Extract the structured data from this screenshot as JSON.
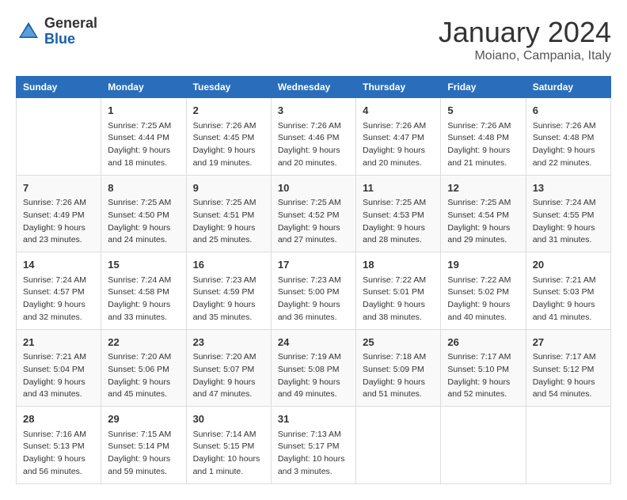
{
  "header": {
    "logo_general": "General",
    "logo_blue": "Blue",
    "month": "January 2024",
    "location": "Moiano, Campania, Italy"
  },
  "days_of_week": [
    "Sunday",
    "Monday",
    "Tuesday",
    "Wednesday",
    "Thursday",
    "Friday",
    "Saturday"
  ],
  "weeks": [
    [
      {
        "day": "",
        "details": ""
      },
      {
        "day": "1",
        "details": "Sunrise: 7:25 AM\nSunset: 4:44 PM\nDaylight: 9 hours\nand 18 minutes."
      },
      {
        "day": "2",
        "details": "Sunrise: 7:26 AM\nSunset: 4:45 PM\nDaylight: 9 hours\nand 19 minutes."
      },
      {
        "day": "3",
        "details": "Sunrise: 7:26 AM\nSunset: 4:46 PM\nDaylight: 9 hours\nand 20 minutes."
      },
      {
        "day": "4",
        "details": "Sunrise: 7:26 AM\nSunset: 4:47 PM\nDaylight: 9 hours\nand 20 minutes."
      },
      {
        "day": "5",
        "details": "Sunrise: 7:26 AM\nSunset: 4:48 PM\nDaylight: 9 hours\nand 21 minutes."
      },
      {
        "day": "6",
        "details": "Sunrise: 7:26 AM\nSunset: 4:48 PM\nDaylight: 9 hours\nand 22 minutes."
      }
    ],
    [
      {
        "day": "7",
        "details": "Sunrise: 7:26 AM\nSunset: 4:49 PM\nDaylight: 9 hours\nand 23 minutes."
      },
      {
        "day": "8",
        "details": "Sunrise: 7:25 AM\nSunset: 4:50 PM\nDaylight: 9 hours\nand 24 minutes."
      },
      {
        "day": "9",
        "details": "Sunrise: 7:25 AM\nSunset: 4:51 PM\nDaylight: 9 hours\nand 25 minutes."
      },
      {
        "day": "10",
        "details": "Sunrise: 7:25 AM\nSunset: 4:52 PM\nDaylight: 9 hours\nand 27 minutes."
      },
      {
        "day": "11",
        "details": "Sunrise: 7:25 AM\nSunset: 4:53 PM\nDaylight: 9 hours\nand 28 minutes."
      },
      {
        "day": "12",
        "details": "Sunrise: 7:25 AM\nSunset: 4:54 PM\nDaylight: 9 hours\nand 29 minutes."
      },
      {
        "day": "13",
        "details": "Sunrise: 7:24 AM\nSunset: 4:55 PM\nDaylight: 9 hours\nand 31 minutes."
      }
    ],
    [
      {
        "day": "14",
        "details": "Sunrise: 7:24 AM\nSunset: 4:57 PM\nDaylight: 9 hours\nand 32 minutes."
      },
      {
        "day": "15",
        "details": "Sunrise: 7:24 AM\nSunset: 4:58 PM\nDaylight: 9 hours\nand 33 minutes."
      },
      {
        "day": "16",
        "details": "Sunrise: 7:23 AM\nSunset: 4:59 PM\nDaylight: 9 hours\nand 35 minutes."
      },
      {
        "day": "17",
        "details": "Sunrise: 7:23 AM\nSunset: 5:00 PM\nDaylight: 9 hours\nand 36 minutes."
      },
      {
        "day": "18",
        "details": "Sunrise: 7:22 AM\nSunset: 5:01 PM\nDaylight: 9 hours\nand 38 minutes."
      },
      {
        "day": "19",
        "details": "Sunrise: 7:22 AM\nSunset: 5:02 PM\nDaylight: 9 hours\nand 40 minutes."
      },
      {
        "day": "20",
        "details": "Sunrise: 7:21 AM\nSunset: 5:03 PM\nDaylight: 9 hours\nand 41 minutes."
      }
    ],
    [
      {
        "day": "21",
        "details": "Sunrise: 7:21 AM\nSunset: 5:04 PM\nDaylight: 9 hours\nand 43 minutes."
      },
      {
        "day": "22",
        "details": "Sunrise: 7:20 AM\nSunset: 5:06 PM\nDaylight: 9 hours\nand 45 minutes."
      },
      {
        "day": "23",
        "details": "Sunrise: 7:20 AM\nSunset: 5:07 PM\nDaylight: 9 hours\nand 47 minutes."
      },
      {
        "day": "24",
        "details": "Sunrise: 7:19 AM\nSunset: 5:08 PM\nDaylight: 9 hours\nand 49 minutes."
      },
      {
        "day": "25",
        "details": "Sunrise: 7:18 AM\nSunset: 5:09 PM\nDaylight: 9 hours\nand 51 minutes."
      },
      {
        "day": "26",
        "details": "Sunrise: 7:17 AM\nSunset: 5:10 PM\nDaylight: 9 hours\nand 52 minutes."
      },
      {
        "day": "27",
        "details": "Sunrise: 7:17 AM\nSunset: 5:12 PM\nDaylight: 9 hours\nand 54 minutes."
      }
    ],
    [
      {
        "day": "28",
        "details": "Sunrise: 7:16 AM\nSunset: 5:13 PM\nDaylight: 9 hours\nand 56 minutes."
      },
      {
        "day": "29",
        "details": "Sunrise: 7:15 AM\nSunset: 5:14 PM\nDaylight: 9 hours\nand 59 minutes."
      },
      {
        "day": "30",
        "details": "Sunrise: 7:14 AM\nSunset: 5:15 PM\nDaylight: 10 hours\nand 1 minute."
      },
      {
        "day": "31",
        "details": "Sunrise: 7:13 AM\nSunset: 5:17 PM\nDaylight: 10 hours\nand 3 minutes."
      },
      {
        "day": "",
        "details": ""
      },
      {
        "day": "",
        "details": ""
      },
      {
        "day": "",
        "details": ""
      }
    ]
  ]
}
